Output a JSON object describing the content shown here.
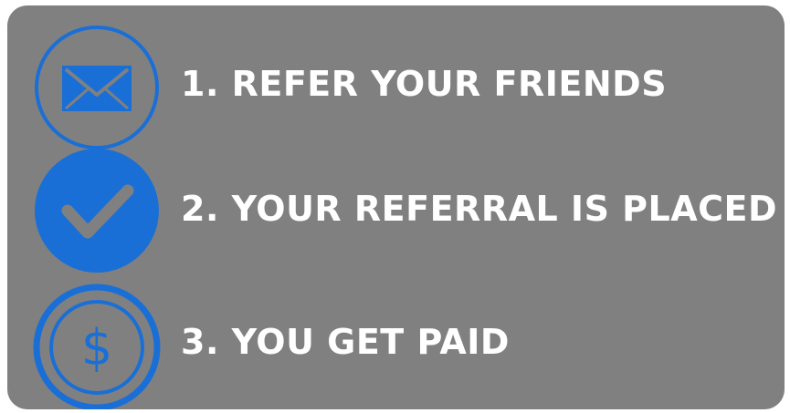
{
  "colors": {
    "panel_background": "#808080",
    "accent_blue": "#1a6fd6",
    "text": "#ffffff"
  },
  "steps": [
    {
      "label": "1. REFER YOUR FRIENDS",
      "icon": "envelope-icon"
    },
    {
      "label": "2. YOUR REFERRAL IS PLACED",
      "icon": "checkmark-icon"
    },
    {
      "label": "3. YOU GET PAID",
      "icon": "dollar-coin-icon"
    }
  ]
}
